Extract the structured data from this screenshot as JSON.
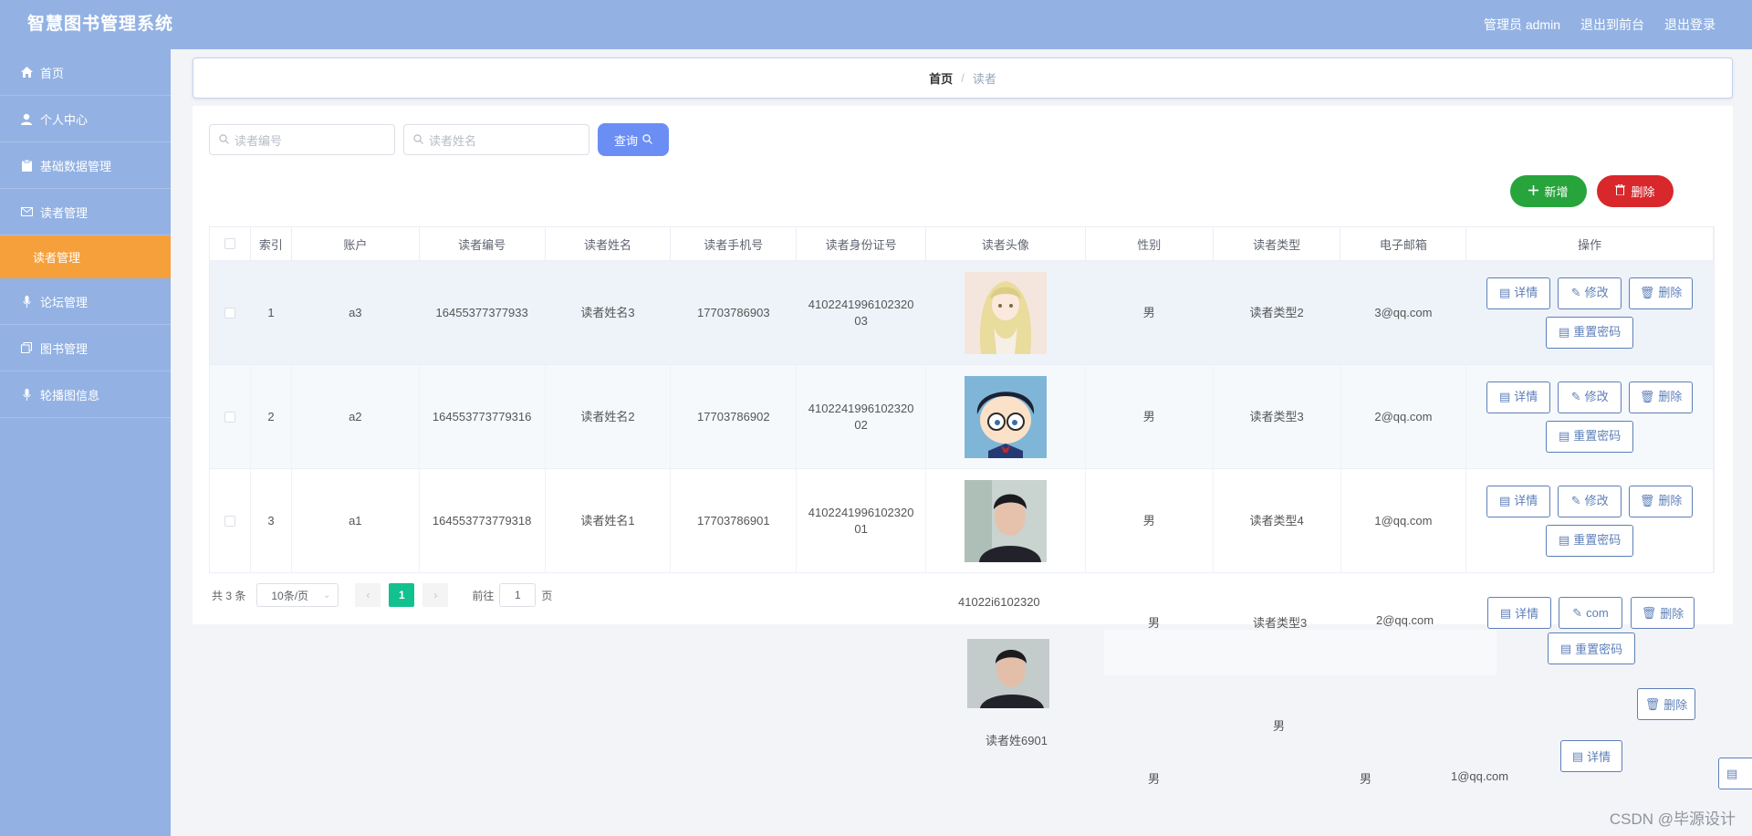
{
  "header": {
    "title": "智慧图书管理系统",
    "admin_label": "管理员 admin",
    "back_front": "退出到前台",
    "logout": "退出登录"
  },
  "sidebar": {
    "items": [
      {
        "label": "首页",
        "icon": "home-icon"
      },
      {
        "label": "个人中心",
        "icon": "user-icon"
      },
      {
        "label": "基础数据管理",
        "icon": "clipboard-icon"
      },
      {
        "label": "读者管理",
        "icon": "envelope-icon"
      },
      {
        "label": "读者管理",
        "icon": ""
      },
      {
        "label": "论坛管理",
        "icon": "microphone-icon"
      },
      {
        "label": "图书管理",
        "icon": "copy-icon"
      },
      {
        "label": "轮播图信息",
        "icon": "microphone-icon"
      }
    ],
    "active_index": 4
  },
  "breadcrumb": {
    "home": "首页",
    "separator": "/",
    "current": "读者"
  },
  "search": {
    "reader_no_placeholder": "读者编号",
    "reader_name_placeholder": "读者姓名",
    "query_label": "查询"
  },
  "actions": {
    "add_label": "新增",
    "delete_label": "删除"
  },
  "table": {
    "columns": [
      "索引",
      "账户",
      "读者编号",
      "读者姓名",
      "读者手机号",
      "读者身份证号",
      "读者头像",
      "性别",
      "读者类型",
      "电子邮箱",
      "操作"
    ],
    "rows": [
      {
        "index": "1",
        "account": "a3",
        "reader_no": "16455377377933",
        "name": "读者姓名3",
        "phone": "17703786903",
        "id_card": "410224199610232003",
        "avatar": "anime-girl-avatar",
        "gender": "男",
        "type": "读者类型2",
        "email": "3@qq.com"
      },
      {
        "index": "2",
        "account": "a2",
        "reader_no": "164553773779316",
        "name": "读者姓名2",
        "phone": "17703786902",
        "id_card": "410224199610232002",
        "avatar": "cartoon-boy-avatar",
        "gender": "男",
        "type": "读者类型3",
        "email": "2@qq.com"
      },
      {
        "index": "3",
        "account": "a1",
        "reader_no": "164553773779318",
        "name": "读者姓名1",
        "phone": "17703786901",
        "id_card": "410224199610232001",
        "avatar": "man-photo-avatar",
        "gender": "男",
        "type": "读者类型4",
        "email": "1@qq.com"
      }
    ],
    "op_labels": {
      "detail": "详情",
      "edit": "修改",
      "delete": "删除",
      "reset_password": "重置密码"
    }
  },
  "pagination": {
    "total_label": "共 3 条",
    "page_size": "10条/页",
    "current_page": "1",
    "goto_label": "前往",
    "goto_value": "1",
    "page_unit": "页"
  },
  "ghost": {
    "id_fragment": "41022i6102320",
    "gender_a": "男",
    "type_a": "读者类型3",
    "email_a": "2@qq.com",
    "detail": "详情",
    "com": "com",
    "delete": "删除",
    "reset": "重置密码",
    "name_fragment": "读者姓6901",
    "gender_b": "男",
    "gender_c": "男",
    "gender_d": "男",
    "email_b": "1@qq.com"
  },
  "watermark": "CSDN @毕源设计"
}
